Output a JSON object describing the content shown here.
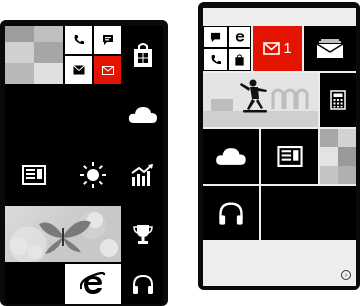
{
  "phones": {
    "left": {
      "tiles": [
        "people-mosaic",
        "phone",
        "messaging",
        "email",
        "store",
        "outlook",
        "news",
        "weather",
        "money",
        "photos",
        "games",
        "internet-explorer",
        "music"
      ]
    },
    "right": {
      "email_tile": {
        "count": "1"
      },
      "all_apps_arrow": "arrow-right-circle"
    }
  },
  "colors": {
    "accent_red": "#e51400",
    "tile_black": "#000000",
    "tile_white": "#ffffff",
    "photo_gray": "#c8c8c8"
  }
}
